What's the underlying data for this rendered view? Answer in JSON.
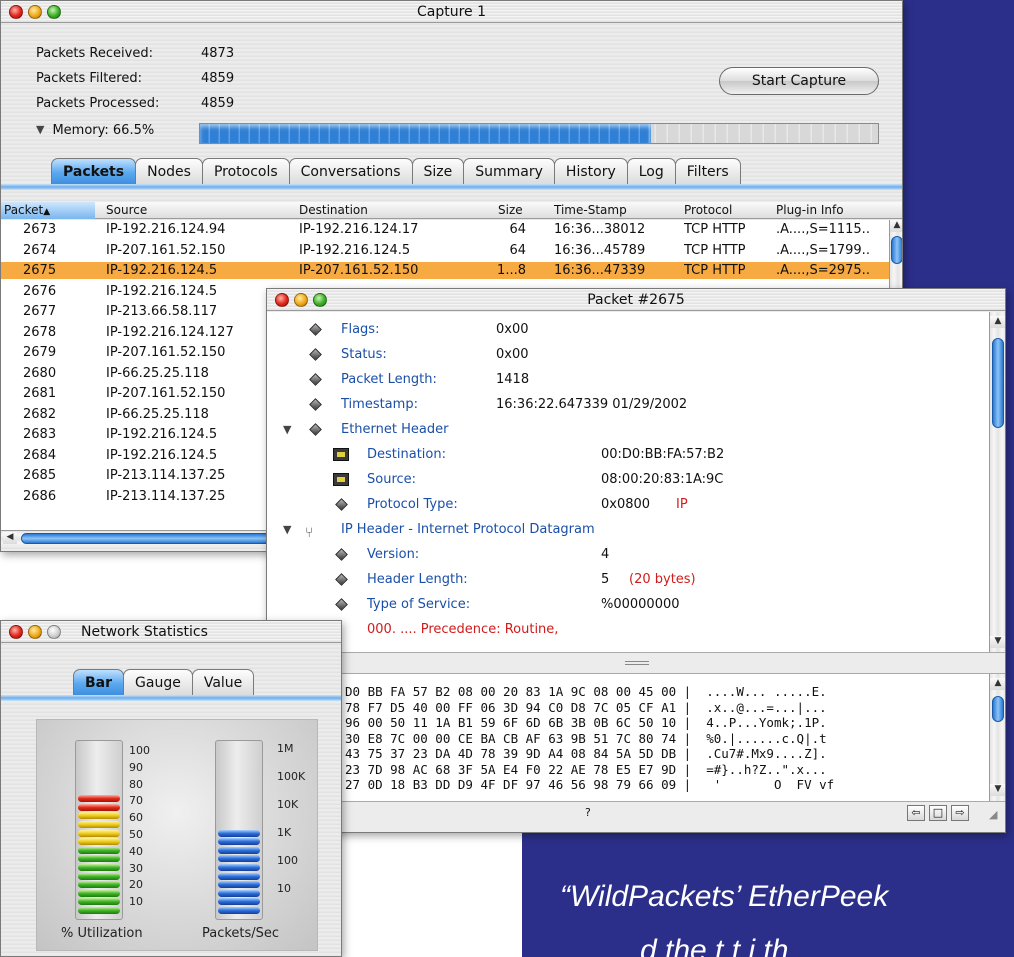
{
  "brand_colors": {
    "background": "#2c2f8a",
    "highlight_row": "#f7a942",
    "aqua": "#3e8fe0"
  },
  "quote": {
    "line1": "“WildPackets’ EtherPeek",
    "line2": "d the t t i th"
  },
  "capture": {
    "title": "Capture 1",
    "stats": [
      {
        "label": "Packets Received:",
        "value": "4873"
      },
      {
        "label": "Packets Filtered:",
        "value": "4859"
      },
      {
        "label": "Packets Processed:",
        "value": "4859"
      }
    ],
    "memory_label": "Memory: 66.5%",
    "memory_fraction": 0.665,
    "start_button": "Start Capture",
    "tabs": [
      "Packets",
      "Nodes",
      "Protocols",
      "Conversations",
      "Size",
      "Summary",
      "History",
      "Log",
      "Filters"
    ],
    "active_tab": 0,
    "columns": [
      "Packet",
      "Source",
      "Destination",
      "Size",
      "Time-Stamp",
      "Protocol",
      "Plug-in Info"
    ],
    "sort_indicator": "▲",
    "rows": [
      [
        "2673",
        "IP-192.216.124.94",
        "IP-192.216.124.17",
        "64",
        "16:36...38012",
        "TCP HTTP",
        ".A....,S=1115.."
      ],
      [
        "2674",
        "IP-207.161.52.150",
        "IP-192.216.124.5",
        "64",
        "16:36...45789",
        "TCP HTTP",
        ".A....,S=1799.."
      ],
      [
        "2675",
        "IP-192.216.124.5",
        "IP-207.161.52.150",
        "1...8",
        "16:36...47339",
        "TCP HTTP",
        ".A....,S=2975.."
      ],
      [
        "2676",
        "IP-192.216.124.5",
        "",
        "",
        "",
        "",
        ""
      ],
      [
        "2677",
        "IP-213.66.58.117",
        "",
        "",
        "",
        "",
        ""
      ],
      [
        "2678",
        "IP-192.216.124.127",
        "",
        "",
        "",
        "",
        ""
      ],
      [
        "2679",
        "IP-207.161.52.150",
        "",
        "",
        "",
        "",
        ""
      ],
      [
        "2680",
        "IP-66.25.25.118",
        "",
        "",
        "",
        "",
        ""
      ],
      [
        "2681",
        "IP-207.161.52.150",
        "",
        "",
        "",
        "",
        ""
      ],
      [
        "2682",
        "IP-66.25.25.118",
        "",
        "",
        "",
        "",
        ""
      ],
      [
        "2683",
        "IP-192.216.124.5",
        "",
        "",
        "",
        "",
        ""
      ],
      [
        "2684",
        "IP-192.216.124.5",
        "",
        "",
        "",
        "",
        ""
      ],
      [
        "2685",
        "IP-213.114.137.25",
        "",
        "",
        "",
        "",
        ""
      ],
      [
        "2686",
        "IP-213.114.137.25",
        "",
        "",
        "",
        "",
        ""
      ]
    ]
  },
  "packet": {
    "title": "Packet #2675",
    "fields": [
      {
        "label": "Flags:",
        "value": "0x00",
        "extra": ""
      },
      {
        "label": "Status:",
        "value": "0x00",
        "extra": ""
      },
      {
        "label": "Packet Length:",
        "value": "1418",
        "extra": ""
      },
      {
        "label": "Timestamp:",
        "value": "16:36:22.647339 01/29/2002",
        "extra": ""
      }
    ],
    "ethernet_header": "Ethernet Header",
    "ethernet_fields": [
      {
        "label": "Destination:",
        "value": "00:D0:BB:FA:57:B2",
        "extra": ""
      },
      {
        "label": "Source:",
        "value": "08:00:20:83:1A:9C",
        "extra": ""
      },
      {
        "label": "Protocol Type:",
        "value": "0x0800",
        "extra": "IP"
      }
    ],
    "ip_header": "IP Header - Internet Protocol Datagram",
    "ip_fields": [
      {
        "label": "Version:",
        "value": "4",
        "extra": ""
      },
      {
        "label": "Header Length:",
        "value": "5",
        "extra": "(20 bytes)"
      },
      {
        "label": "Type of Service:",
        "value": "%00000000",
        "extra": ""
      }
    ],
    "precedence": "000. .... Precedence: Routine,",
    "hex_lines": [
      "D0 BB FA 57 B2 08 00 20 83 1A 9C 08 00 45 00 |  ....W... .....E.",
      "78 F7 D5 40 00 FF 06 3D 94 C0 D8 7C 05 CF A1 |  .x..@...=...|...",
      "96 00 50 11 1A B1 59 6F 6D 6B 3B 0B 6C 50 10 |  4..P...Yomk;.1P.",
      "30 E8 7C 00 00 CE BA CB AF 63 9B 51 7C 80 74 |  %0.|......c.Q|.t",
      "43 75 37 23 DA 4D 78 39 9D A4 08 84 5A 5D DB |  .Cu7#.Mx9....Z].",
      "23 7D 98 AC 68 3F 5A E4 F0 22 AE 78 E5 E7 9D |  =#}..h?Z..\".x...",
      "27 0D 18 B3 DD D9 4F DF 97 46 56 98 79 66 09 |   '       O  FV vf"
    ],
    "status_text": "?"
  },
  "netstats": {
    "title": "Network Statistics",
    "tabs": [
      "Bar",
      "Gauge",
      "Value"
    ],
    "active_tab": 0,
    "utilization_ticks": [
      "100",
      "90",
      "80",
      "70",
      "60",
      "50",
      "40",
      "30",
      "20",
      "10"
    ],
    "packets_ticks": [
      "1M",
      "100K",
      "10K",
      "1K",
      "100",
      "10"
    ],
    "utilization_caption": "% Utilization",
    "packets_caption": "Packets/Sec",
    "utilization_percent": 82,
    "packets_level_fraction": 0.6
  }
}
